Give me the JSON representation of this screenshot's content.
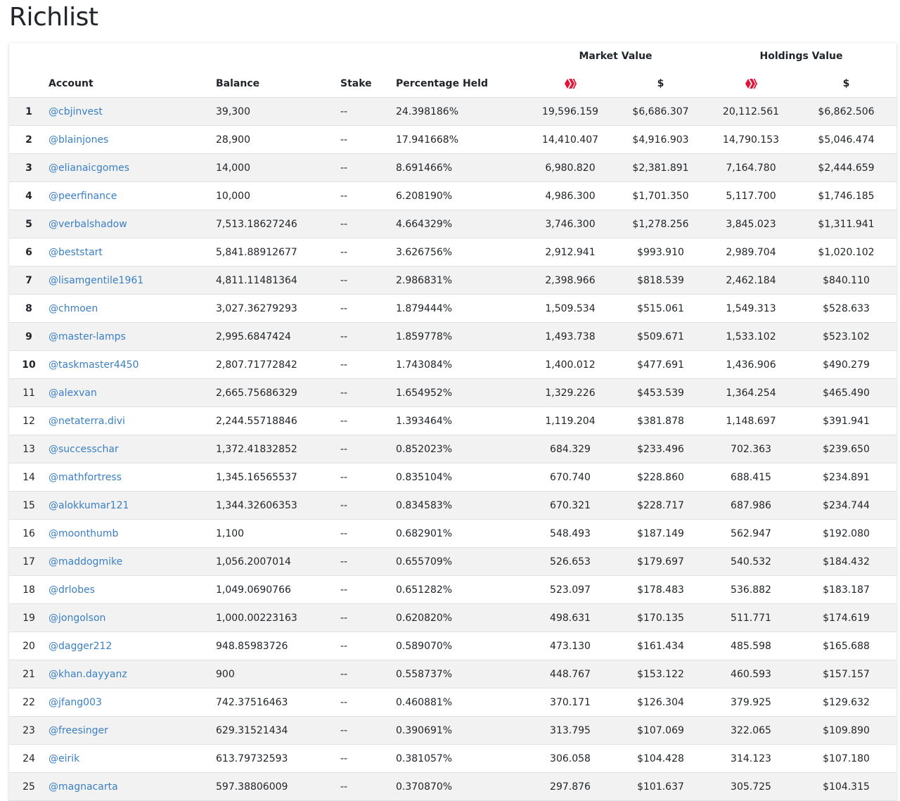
{
  "page": {
    "title": "Richlist"
  },
  "table": {
    "group_headers": {
      "market_value": "Market Value",
      "holdings_value": "Holdings Value"
    },
    "columns": {
      "account": "Account",
      "balance": "Balance",
      "stake": "Stake",
      "percentage": "Percentage Held",
      "market_usd": "$",
      "holdings_usd": "$"
    },
    "token_icon": {
      "name": "hive-icon",
      "color": "#e31337"
    },
    "rows": [
      {
        "rank": "1",
        "account": "@cbjinvest",
        "balance": "39,300",
        "stake": "--",
        "pct": "24.398186%",
        "mv_hive": "19,596.159",
        "mv_usd": "$6,686.307",
        "hv_hive": "20,112.561",
        "hv_usd": "$6,862.506"
      },
      {
        "rank": "2",
        "account": "@blainjones",
        "balance": "28,900",
        "stake": "--",
        "pct": "17.941668%",
        "mv_hive": "14,410.407",
        "mv_usd": "$4,916.903",
        "hv_hive": "14,790.153",
        "hv_usd": "$5,046.474"
      },
      {
        "rank": "3",
        "account": "@elianaicgomes",
        "balance": "14,000",
        "stake": "--",
        "pct": "8.691466%",
        "mv_hive": "6,980.820",
        "mv_usd": "$2,381.891",
        "hv_hive": "7,164.780",
        "hv_usd": "$2,444.659"
      },
      {
        "rank": "4",
        "account": "@peerfinance",
        "balance": "10,000",
        "stake": "--",
        "pct": "6.208190%",
        "mv_hive": "4,986.300",
        "mv_usd": "$1,701.350",
        "hv_hive": "5,117.700",
        "hv_usd": "$1,746.185"
      },
      {
        "rank": "5",
        "account": "@verbalshadow",
        "balance": "7,513.18627246",
        "stake": "--",
        "pct": "4.664329%",
        "mv_hive": "3,746.300",
        "mv_usd": "$1,278.256",
        "hv_hive": "3,845.023",
        "hv_usd": "$1,311.941"
      },
      {
        "rank": "6",
        "account": "@beststart",
        "balance": "5,841.88912677",
        "stake": "--",
        "pct": "3.626756%",
        "mv_hive": "2,912.941",
        "mv_usd": "$993.910",
        "hv_hive": "2,989.704",
        "hv_usd": "$1,020.102"
      },
      {
        "rank": "7",
        "account": "@lisamgentile1961",
        "balance": "4,811.11481364",
        "stake": "--",
        "pct": "2.986831%",
        "mv_hive": "2,398.966",
        "mv_usd": "$818.539",
        "hv_hive": "2,462.184",
        "hv_usd": "$840.110"
      },
      {
        "rank": "8",
        "account": "@chmoen",
        "balance": "3,027.36279293",
        "stake": "--",
        "pct": "1.879444%",
        "mv_hive": "1,509.534",
        "mv_usd": "$515.061",
        "hv_hive": "1,549.313",
        "hv_usd": "$528.633"
      },
      {
        "rank": "9",
        "account": "@master-lamps",
        "balance": "2,995.6847424",
        "stake": "--",
        "pct": "1.859778%",
        "mv_hive": "1,493.738",
        "mv_usd": "$509.671",
        "hv_hive": "1,533.102",
        "hv_usd": "$523.102"
      },
      {
        "rank": "10",
        "account": "@taskmaster4450",
        "balance": "2,807.71772842",
        "stake": "--",
        "pct": "1.743084%",
        "mv_hive": "1,400.012",
        "mv_usd": "$477.691",
        "hv_hive": "1,436.906",
        "hv_usd": "$490.279"
      },
      {
        "rank": "11",
        "account": "@alexvan",
        "balance": "2,665.75686329",
        "stake": "--",
        "pct": "1.654952%",
        "mv_hive": "1,329.226",
        "mv_usd": "$453.539",
        "hv_hive": "1,364.254",
        "hv_usd": "$465.490"
      },
      {
        "rank": "12",
        "account": "@netaterra.divi",
        "balance": "2,244.55718846",
        "stake": "--",
        "pct": "1.393464%",
        "mv_hive": "1,119.204",
        "mv_usd": "$381.878",
        "hv_hive": "1,148.697",
        "hv_usd": "$391.941"
      },
      {
        "rank": "13",
        "account": "@successchar",
        "balance": "1,372.41832852",
        "stake": "--",
        "pct": "0.852023%",
        "mv_hive": "684.329",
        "mv_usd": "$233.496",
        "hv_hive": "702.363",
        "hv_usd": "$239.650"
      },
      {
        "rank": "14",
        "account": "@mathfortress",
        "balance": "1,345.16565537",
        "stake": "--",
        "pct": "0.835104%",
        "mv_hive": "670.740",
        "mv_usd": "$228.860",
        "hv_hive": "688.415",
        "hv_usd": "$234.891"
      },
      {
        "rank": "15",
        "account": "@alokkumar121",
        "balance": "1,344.32606353",
        "stake": "--",
        "pct": "0.834583%",
        "mv_hive": "670.321",
        "mv_usd": "$228.717",
        "hv_hive": "687.986",
        "hv_usd": "$234.744"
      },
      {
        "rank": "16",
        "account": "@moonthumb",
        "balance": "1,100",
        "stake": "--",
        "pct": "0.682901%",
        "mv_hive": "548.493",
        "mv_usd": "$187.149",
        "hv_hive": "562.947",
        "hv_usd": "$192.080"
      },
      {
        "rank": "17",
        "account": "@maddogmike",
        "balance": "1,056.2007014",
        "stake": "--",
        "pct": "0.655709%",
        "mv_hive": "526.653",
        "mv_usd": "$179.697",
        "hv_hive": "540.532",
        "hv_usd": "$184.432"
      },
      {
        "rank": "18",
        "account": "@drlobes",
        "balance": "1,049.0690766",
        "stake": "--",
        "pct": "0.651282%",
        "mv_hive": "523.097",
        "mv_usd": "$178.483",
        "hv_hive": "536.882",
        "hv_usd": "$183.187"
      },
      {
        "rank": "19",
        "account": "@jongolson",
        "balance": "1,000.00223163",
        "stake": "--",
        "pct": "0.620820%",
        "mv_hive": "498.631",
        "mv_usd": "$170.135",
        "hv_hive": "511.771",
        "hv_usd": "$174.619"
      },
      {
        "rank": "20",
        "account": "@dagger212",
        "balance": "948.85983726",
        "stake": "--",
        "pct": "0.589070%",
        "mv_hive": "473.130",
        "mv_usd": "$161.434",
        "hv_hive": "485.598",
        "hv_usd": "$165.688"
      },
      {
        "rank": "21",
        "account": "@khan.dayyanz",
        "balance": "900",
        "stake": "--",
        "pct": "0.558737%",
        "mv_hive": "448.767",
        "mv_usd": "$153.122",
        "hv_hive": "460.593",
        "hv_usd": "$157.157"
      },
      {
        "rank": "22",
        "account": "@jfang003",
        "balance": "742.37516463",
        "stake": "--",
        "pct": "0.460881%",
        "mv_hive": "370.171",
        "mv_usd": "$126.304",
        "hv_hive": "379.925",
        "hv_usd": "$129.632"
      },
      {
        "rank": "23",
        "account": "@freesinger",
        "balance": "629.31521434",
        "stake": "--",
        "pct": "0.390691%",
        "mv_hive": "313.795",
        "mv_usd": "$107.069",
        "hv_hive": "322.065",
        "hv_usd": "$109.890"
      },
      {
        "rank": "24",
        "account": "@eirik",
        "balance": "613.79732593",
        "stake": "--",
        "pct": "0.381057%",
        "mv_hive": "306.058",
        "mv_usd": "$104.428",
        "hv_hive": "314.123",
        "hv_usd": "$107.180"
      },
      {
        "rank": "25",
        "account": "@magnacarta",
        "balance": "597.38806009",
        "stake": "--",
        "pct": "0.370870%",
        "mv_hive": "297.876",
        "mv_usd": "$101.637",
        "hv_hive": "305.725",
        "hv_usd": "$104.315"
      }
    ]
  }
}
